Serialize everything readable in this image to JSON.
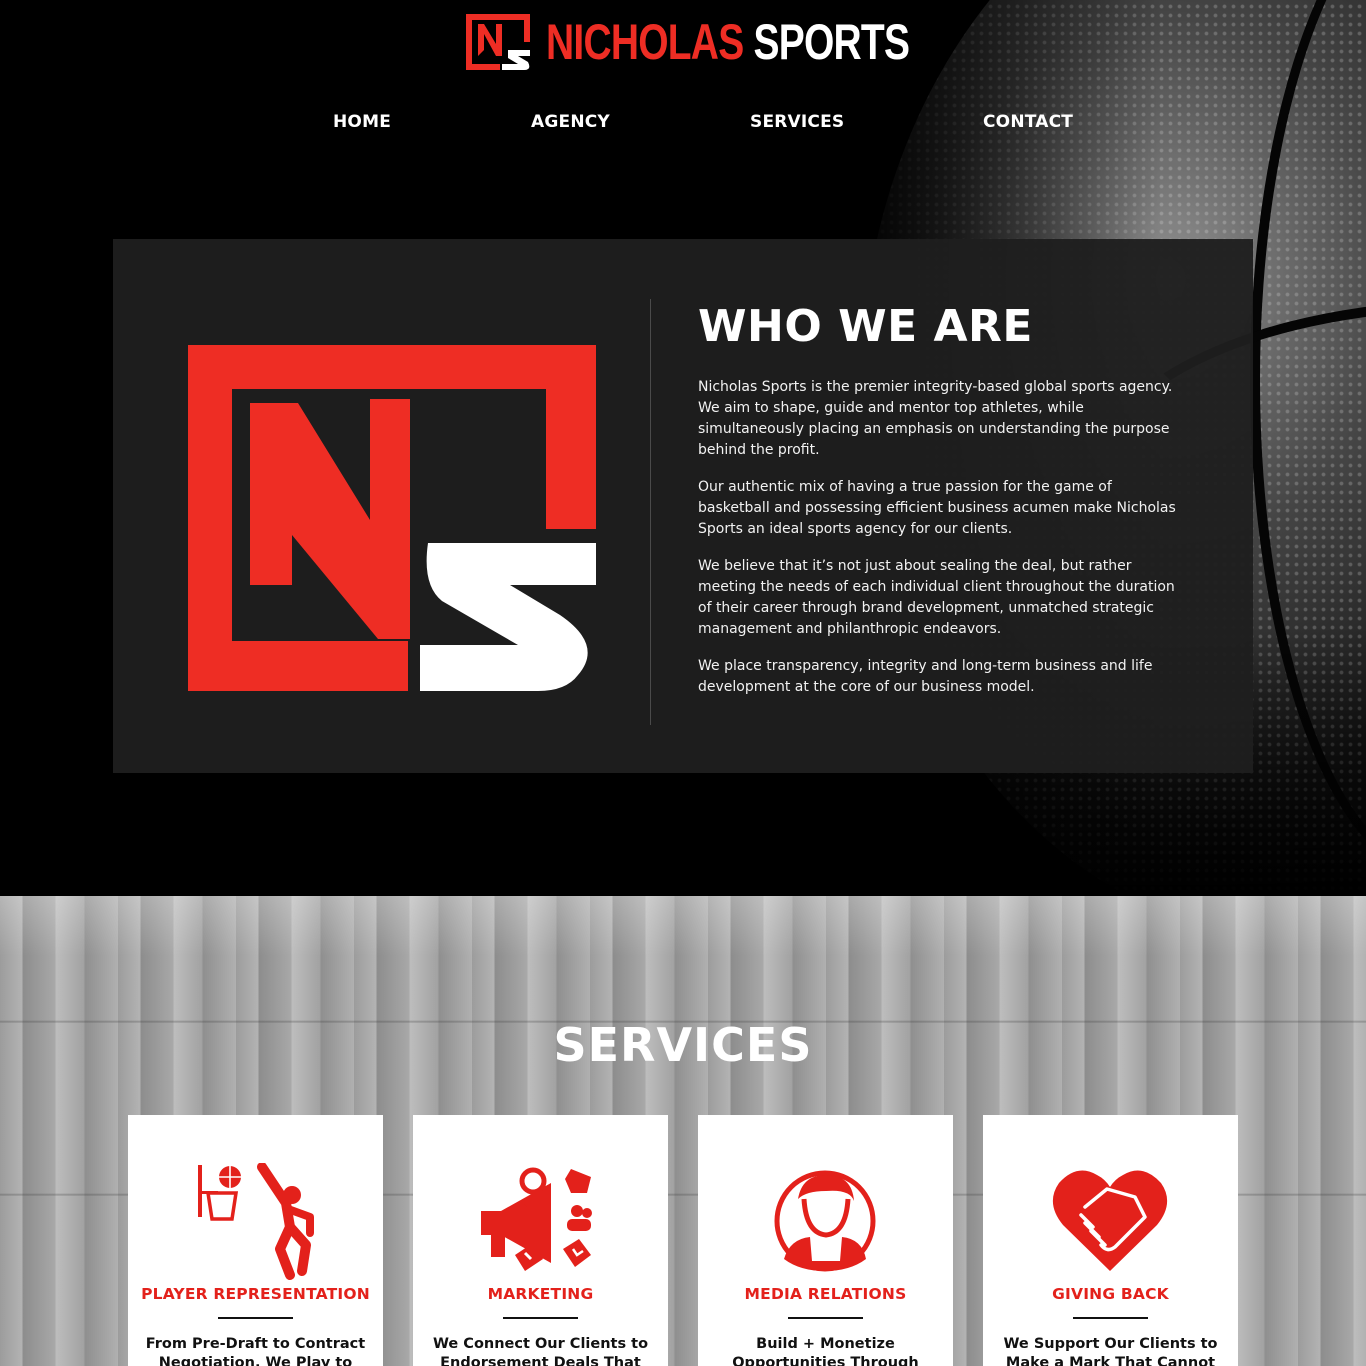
{
  "brand": {
    "name_part1": "NICHOLAS",
    "name_part2": "SPORTS",
    "logo_icon": "ns-monogram-logo",
    "colors": {
      "red": "#ee2d24",
      "white": "#ffffff",
      "black": "#000000"
    }
  },
  "nav": {
    "items": [
      {
        "label": "HOME"
      },
      {
        "label": "AGENCY"
      },
      {
        "label": "SERVICES"
      },
      {
        "label": "CONTACT"
      }
    ]
  },
  "about": {
    "title": "WHO WE ARE",
    "paragraphs": [
      "Nicholas Sports is the premier integrity-based global sports agency. We aim to shape, guide and mentor top athletes, while simultaneously placing an emphasis on understanding the purpose behind the profit.",
      "Our authentic mix of having a true passion for the game of basketball and possessing efficient business acumen make Nicholas Sports an ideal sports agency for our clients.",
      "We believe that it’s not just about sealing the deal, but rather meeting the needs of each individual client throughout the duration of their career through brand development, unmatched strategic management and philanthropic endeavors.",
      "We place transparency, integrity and long-term business and life development at the core of our business model."
    ],
    "logo_icon": "ns-monogram-logo-large"
  },
  "services": {
    "title": "SERVICES",
    "cards": [
      {
        "icon": "basketball-player-dunk-icon",
        "title": "PLAYER REPRESENTATION",
        "text": "From Pre-Draft to Contract Negotiation, We Play to Win!"
      },
      {
        "icon": "megaphone-marketing-icon",
        "title": "MARKETING",
        "text": "We Connect Our Clients to Endorsement Deals That Match"
      },
      {
        "icon": "person-portrait-icon",
        "title": "MEDIA RELATIONS",
        "text": "Build + Monetize Opportunities Through Social Media and"
      },
      {
        "icon": "heart-handshake-icon",
        "title": "GIVING BACK",
        "text": "We Support Our Clients to Make a Mark That Cannot Be"
      }
    ]
  }
}
